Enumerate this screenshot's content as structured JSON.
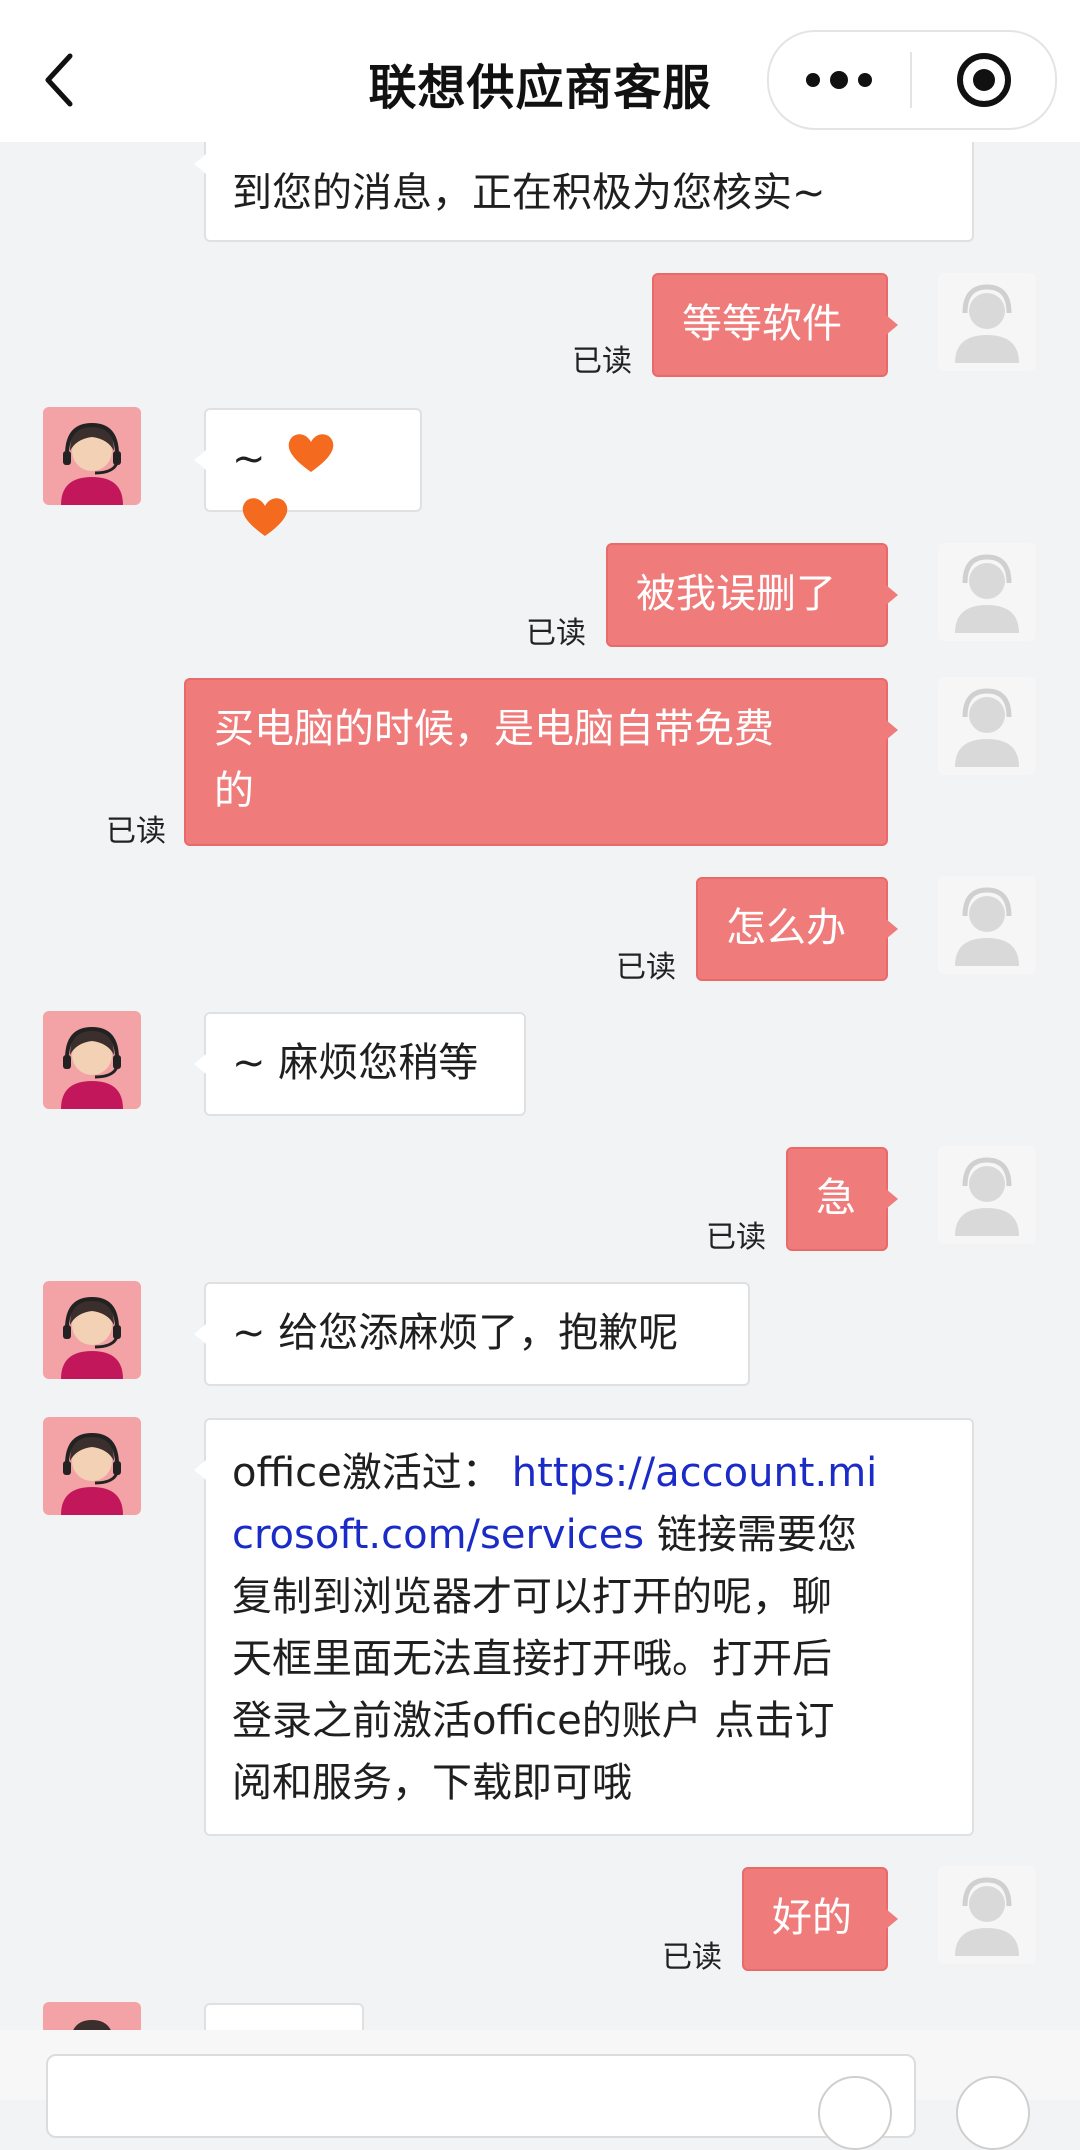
{
  "header": {
    "title": "联想供应商客服"
  },
  "read_label": "已读",
  "messages": {
    "m0_line2": "到您的消息，正在积极为您核实~",
    "m1": "等等软件",
    "m2_tilde": "~",
    "m3": "被我误删了",
    "m4_line1": "买电脑的时候，是电脑自带免费",
    "m4_line2": "的",
    "m5": "怎么办",
    "m6": "~ 麻烦您稍等",
    "m7": "急",
    "m8": "~ 给您添麻烦了，抱歉呢",
    "m9_prefix": "office激活过：",
    "m9_link_1": "https://account.mi",
    "m9_link_2": "crosoft.com/services",
    "m9_after_link": " 链接需要您",
    "m9_line3": "复制到浏览器才可以打开的呢，聊",
    "m9_line4": "天框里面无法直接打开哦。打开后",
    "m9_line5": "登录之前激活office的账户 点击订",
    "m9_line6": "阅和服务，下载即可哦",
    "m10": "好的"
  },
  "icons": {
    "back": "chevron-left-icon",
    "more": "more-dots-icon",
    "close": "target-circle-icon",
    "agent_avatar": "customer-service-avatar",
    "user_avatar": "default-user-avatar",
    "heart": "orange-heart-emoji"
  },
  "colors": {
    "user_bubble": "#f07b7b",
    "link": "#1b2bc8",
    "background": "#f2f3f5"
  }
}
